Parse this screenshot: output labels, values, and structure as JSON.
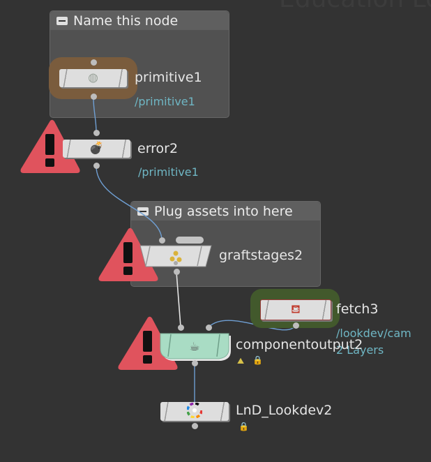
{
  "background_title": "Education Lo",
  "netboxes": {
    "name_box": {
      "title": "Name this node"
    },
    "plug_box": {
      "title": "Plug assets into here"
    }
  },
  "nodes": {
    "primitive1": {
      "name": "primitive1",
      "path": "/primitive1",
      "icon": "sphere-icon"
    },
    "error2": {
      "name": "error2",
      "path": "/primitive1",
      "icon": "bomb-icon"
    },
    "graftstages2": {
      "name": "graftstages2",
      "icon": "graft-icon"
    },
    "fetch3": {
      "name": "fetch3",
      "path": "/lookdev/cam",
      "info": "2 Layers",
      "icon": "fetch-icon"
    },
    "componentoutput2": {
      "name": "componentoutput2",
      "icon": "teacup-icon"
    },
    "lnd_lookdev2": {
      "name": "LnD_Lookdev2",
      "icon": "color-wheel-icon"
    }
  },
  "colors": {
    "background": "#333333",
    "warning": "#e0535d",
    "wire": "#6f9fd3",
    "output_node": "#a9dcc4",
    "selection_halo": "#7a5c3d",
    "fetch_halo": "#42592c",
    "path_text": "#6fb6c4"
  }
}
